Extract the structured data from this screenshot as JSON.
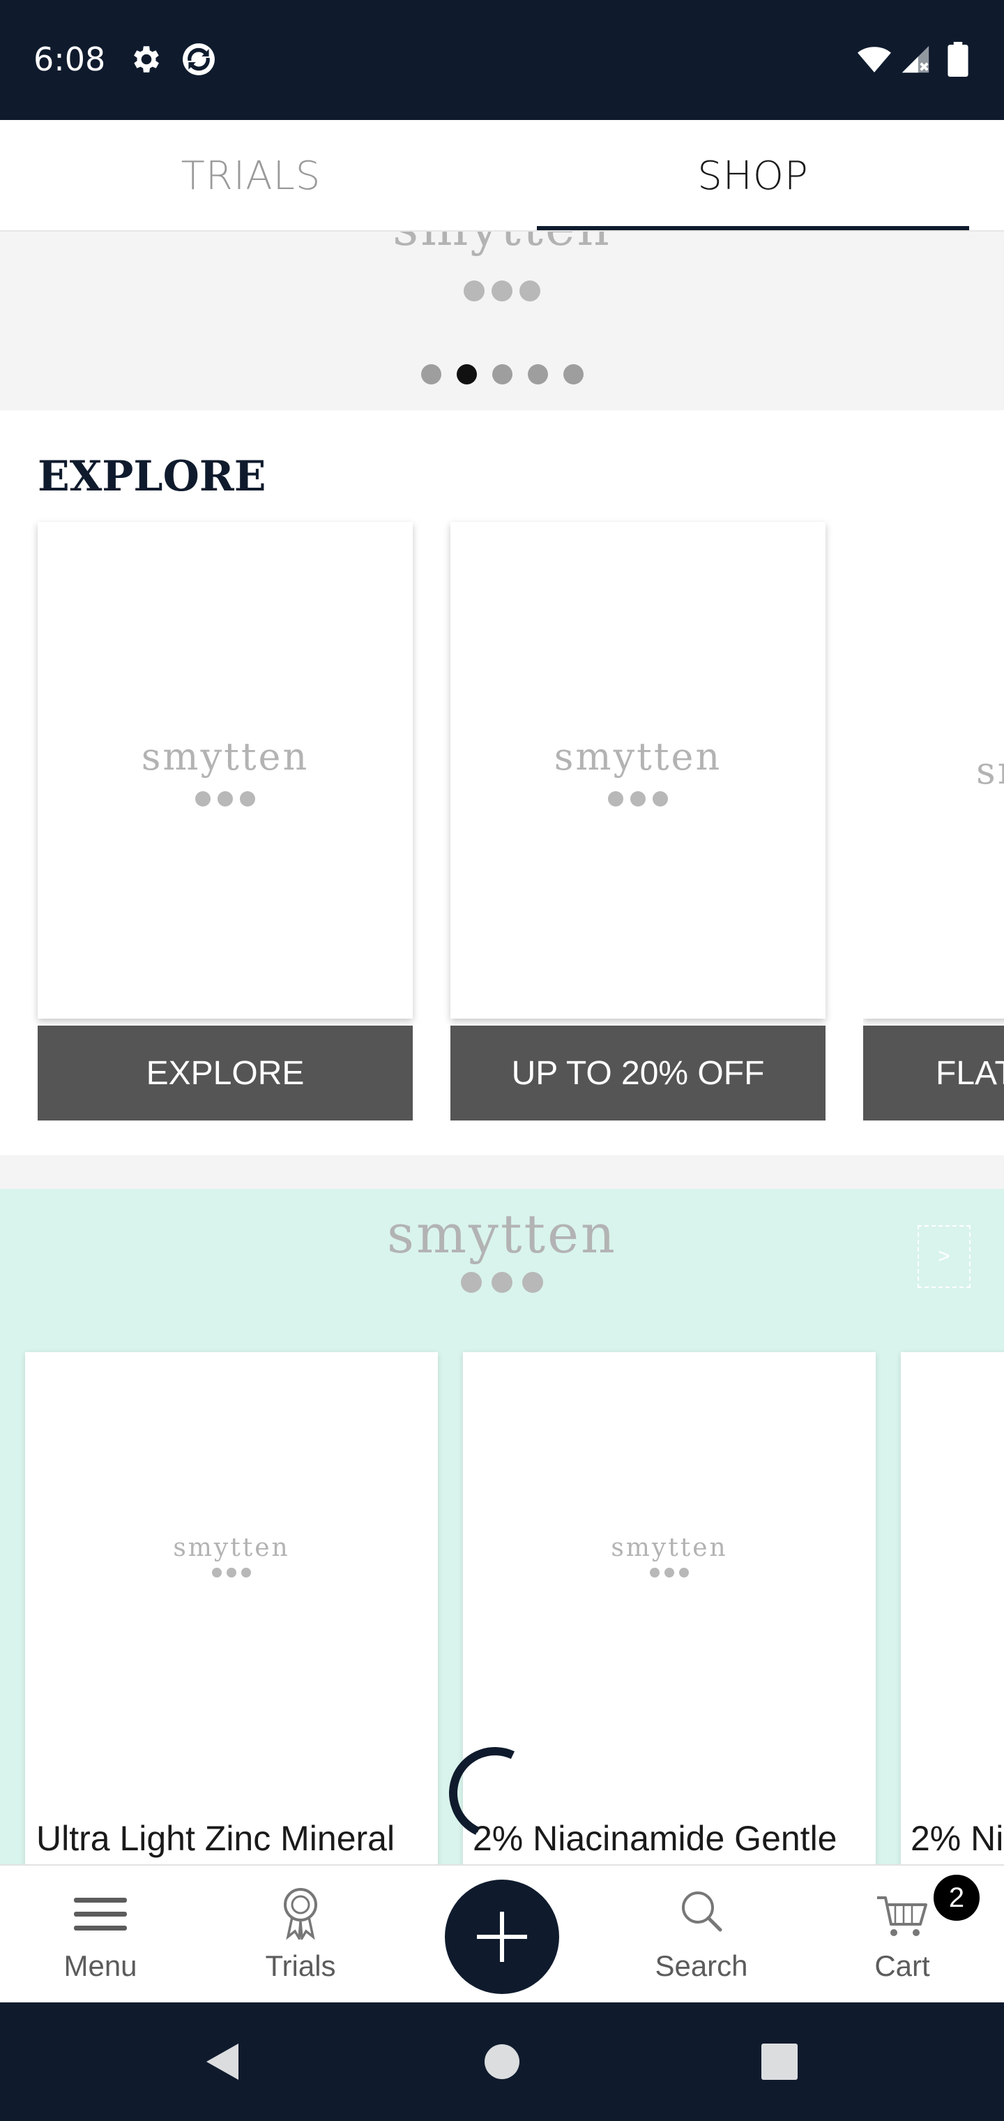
{
  "status_bar": {
    "time": "6:08",
    "icons": [
      "settings-icon",
      "sync-icon",
      "wifi-icon",
      "signal-icon",
      "battery-icon"
    ]
  },
  "tabs": [
    {
      "label": "TRIALS",
      "active": false
    },
    {
      "label": "SHOP",
      "active": true
    }
  ],
  "banner": {
    "logo": "smytten",
    "carousel_count": 5,
    "active_index": 1
  },
  "explore": {
    "title": "EXPLORE",
    "cards": [
      {
        "logo": "smytten",
        "label": "EXPLORE"
      },
      {
        "logo": "smytten",
        "label": "UP TO 20% OFF"
      },
      {
        "logo": "sm",
        "label": "FLAT"
      }
    ]
  },
  "products": {
    "logo": "smytten",
    "next_label": ">",
    "items": [
      {
        "logo": "smytten",
        "name": "Ultra Light Zinc Mineral"
      },
      {
        "logo": "smytten",
        "name": "2% Niacinamide Gentle"
      },
      {
        "logo": "",
        "name": "2% Ni"
      }
    ]
  },
  "bottom_nav": {
    "items": [
      {
        "label": "Menu",
        "icon": "menu-icon"
      },
      {
        "label": "Trials",
        "icon": "award-icon"
      },
      {
        "label": "Search",
        "icon": "search-icon"
      },
      {
        "label": "Cart",
        "icon": "cart-icon"
      }
    ],
    "cart_badge": "2"
  },
  "colors": {
    "navy": "#0f1b2d",
    "mint": "#d9f4ec",
    "label_gray": "#555555"
  }
}
